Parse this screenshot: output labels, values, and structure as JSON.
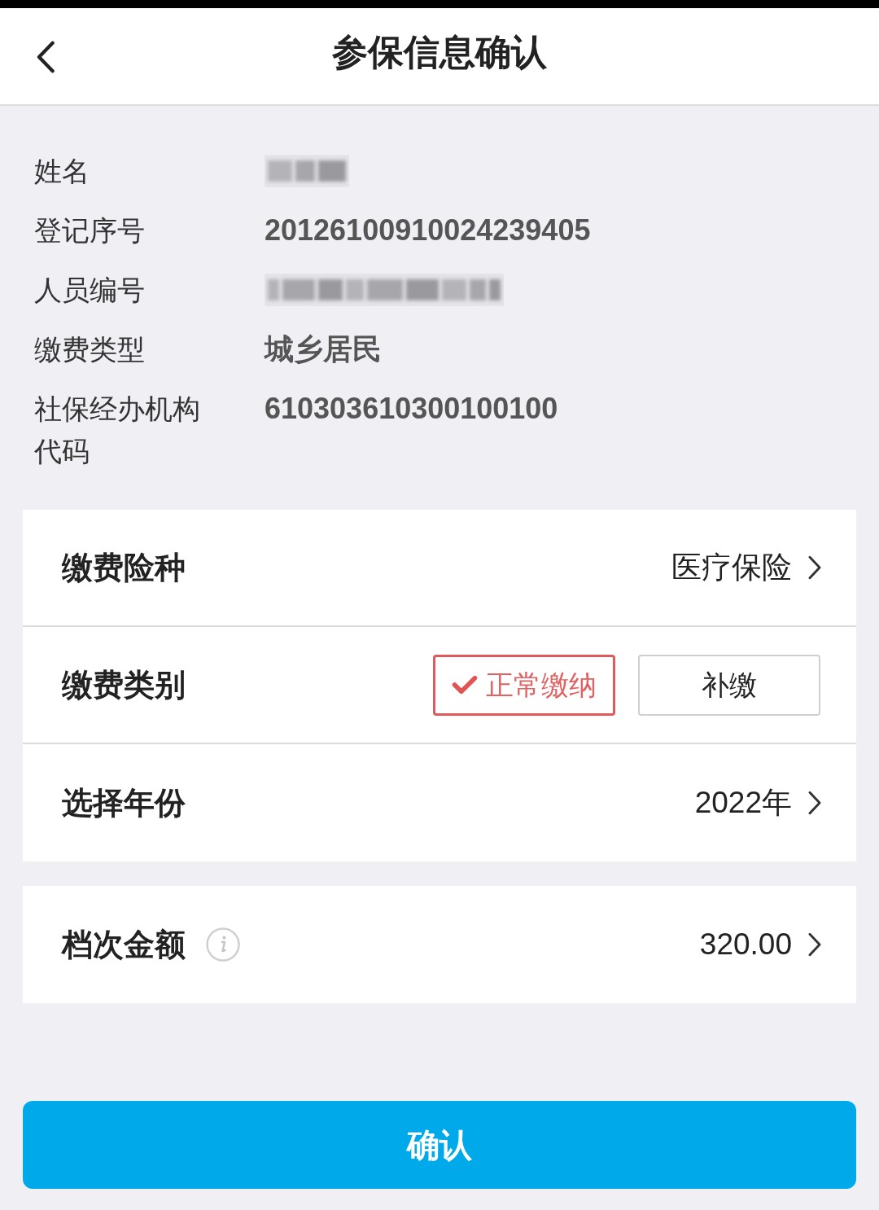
{
  "header": {
    "title": "参保信息确认"
  },
  "info_rows": [
    {
      "label": "姓名",
      "kind": "blurred_short"
    },
    {
      "label": "登记序号",
      "kind": "text",
      "value": "20126100910024239405"
    },
    {
      "label": "人员编号",
      "kind": "blurred_long"
    },
    {
      "label": "缴费类型",
      "kind": "text",
      "value": "城乡居民"
    },
    {
      "label": "社保经办机构代码",
      "kind": "text",
      "value": "610303610300100100"
    }
  ],
  "cards": [
    {
      "rows": [
        {
          "kind": "select",
          "label": "缴费险种",
          "value": "医疗保险",
          "info": false
        },
        {
          "kind": "choice",
          "label": "缴费类别",
          "options": [
            {
              "label": "正常缴纳",
              "selected": true
            },
            {
              "label": "补缴",
              "selected": false
            }
          ]
        },
        {
          "kind": "select",
          "label": "选择年份",
          "value": "2022年",
          "info": false
        }
      ]
    },
    {
      "rows": [
        {
          "kind": "select",
          "label": "档次金额",
          "value": "320.00",
          "info": true
        }
      ]
    }
  ],
  "confirm_button": {
    "label": "确认"
  }
}
